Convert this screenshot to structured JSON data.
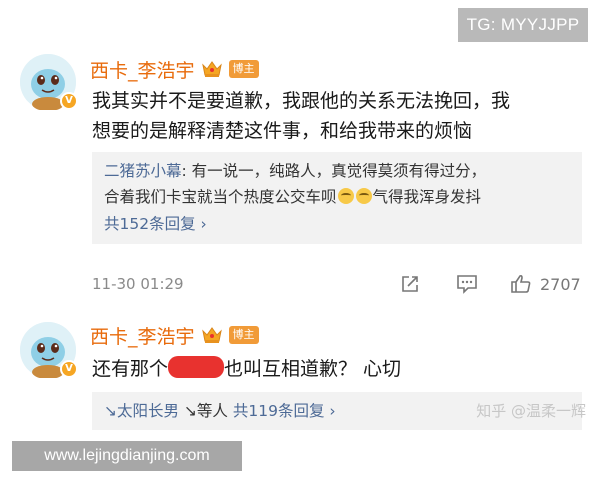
{
  "overlay": {
    "top_watermark": "TG: MYYJJPP",
    "bottom_watermark": "www.lejingdianjing.com",
    "zhihu_watermark": "知乎 @温柔一辉"
  },
  "comments": [
    {
      "username": "西卡_李浩宇",
      "tag": "博主",
      "text_line1": "我其实并不是要道歉，我跟他的关系无法挽回，我",
      "text_line2": "想要的是解释清楚这件事，和给我带来的烦恼",
      "reply": {
        "user": "二猪苏小幕",
        "sep": ": ",
        "line1": "有一说一，纯路人，真觉得莫须有得过分，",
        "line2a": "合着我们卡宝就当个热度公交车呗",
        "line2b": "气得我浑身发抖",
        "count": "共152条回复 ›"
      },
      "timestamp": "11-30 01:29",
      "likes": "2707"
    },
    {
      "username": "西卡_李浩宇",
      "tag": "博主",
      "text_a": "还有那个",
      "text_b": "也叫互相道歉？ 心切",
      "reply_summary": {
        "first": "↘太阳长男",
        "second": "↘等人",
        "count": "共119条回复 ›"
      }
    }
  ]
}
